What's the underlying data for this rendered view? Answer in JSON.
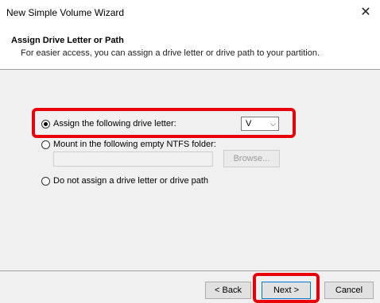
{
  "window": {
    "title": "New Simple Volume Wizard",
    "close_glyph": "✕"
  },
  "header": {
    "title": "Assign Drive Letter or Path",
    "subtitle": "For easier access, you can assign a drive letter or drive path to your partition."
  },
  "options": [
    {
      "label": "Assign the following drive letter:",
      "selected": true
    },
    {
      "label": "Mount in the following empty NTFS folder:",
      "selected": false
    },
    {
      "label": "Do not assign a drive letter or drive path",
      "selected": false
    }
  ],
  "drive_letter": {
    "value": "V",
    "chevron": "⌵"
  },
  "folder": {
    "value": "",
    "browse_label": "Browse..."
  },
  "buttons": {
    "back": "< Back",
    "next": "Next >",
    "cancel": "Cancel"
  },
  "colors": {
    "highlight": "#e8000b",
    "accent": "#0078d7"
  }
}
